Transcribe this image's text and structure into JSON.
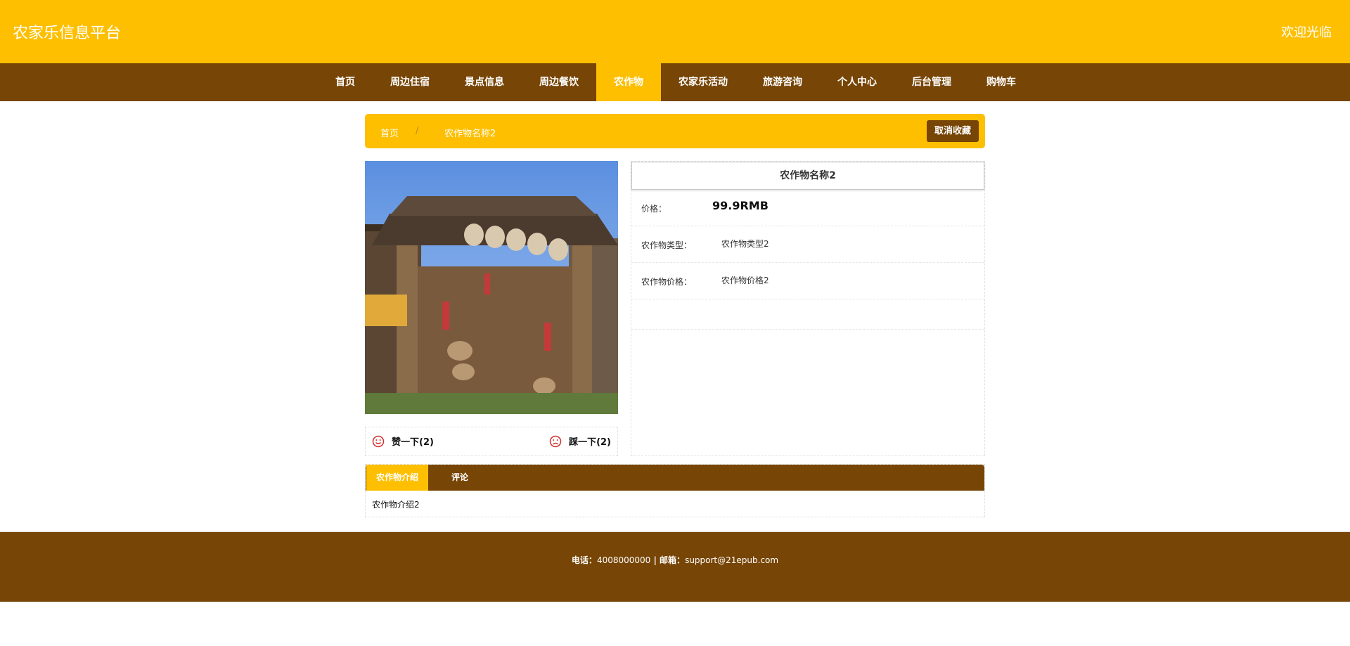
{
  "header": {
    "site_title": "农家乐信息平台",
    "welcome": "欢迎光临"
  },
  "nav": {
    "items": [
      {
        "label": "首页"
      },
      {
        "label": "周边住宿"
      },
      {
        "label": "景点信息"
      },
      {
        "label": "周边餐饮"
      },
      {
        "label": "农作物"
      },
      {
        "label": "农家乐活动"
      },
      {
        "label": "旅游咨询"
      },
      {
        "label": "个人中心"
      },
      {
        "label": "后台管理"
      },
      {
        "label": "购物车"
      }
    ],
    "active": "农作物"
  },
  "breadcrumb": {
    "home": "首页",
    "separator": "/",
    "current": "农作物名称2",
    "uncollect_button": "取消收藏"
  },
  "votes": {
    "like": "赞一下(2)",
    "dislike": "踩一下(2)"
  },
  "detail": {
    "name": "农作物名称2",
    "price_label": "价格：",
    "price_value": "99.9RMB",
    "type_label": "农作物类型：",
    "type_value": "农作物类型2",
    "crop_price_label": "农作物价格：",
    "crop_price_value": "农作物价格2"
  },
  "tabs": {
    "intro": "农作物介绍",
    "comment": "评论",
    "intro_content": "农作物介绍2"
  },
  "footer": {
    "phone_label": "电话：",
    "phone": "4008000000",
    "separator": " | ",
    "email_label": "邮箱：",
    "email": "support@21epub.com"
  },
  "colors": {
    "primary": "#fdbf00",
    "secondary": "#774505"
  }
}
